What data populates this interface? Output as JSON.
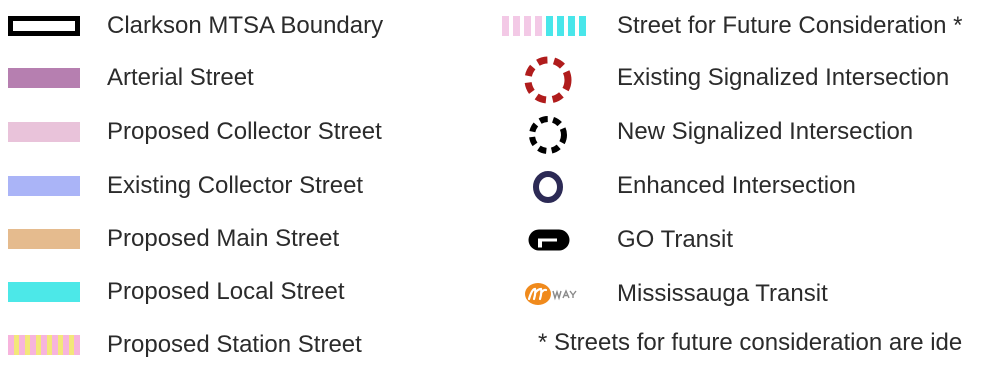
{
  "legend": {
    "left": [
      {
        "label": "Clarkson MTSA Boundary",
        "symbol": "boundary-box-icon",
        "color": "#000000"
      },
      {
        "label": "Arterial Street",
        "symbol": "arterial-street-swatch",
        "color": "#b67fb0"
      },
      {
        "label": "Proposed Collector Street",
        "symbol": "proposed-collector-swatch",
        "color": "#e9c3da"
      },
      {
        "label": "Existing Collector Street",
        "symbol": "existing-collector-swatch",
        "color": "#aab4f7"
      },
      {
        "label": "Proposed Main Street",
        "symbol": "proposed-main-swatch",
        "color": "#e5bb8e"
      },
      {
        "label": "Proposed Local Street",
        "symbol": "proposed-local-swatch",
        "color": "#4ce8e8"
      },
      {
        "label": "Proposed Station Street",
        "symbol": "proposed-station-striped-swatch",
        "color": "#f7b4dd / #f3e77a"
      }
    ],
    "right": [
      {
        "label": "Street for Future Consideration *",
        "symbol": "future-street-striped-swatch",
        "color": "#f3c9e6 / #49e6ea"
      },
      {
        "label": "Existing Signalized Intersection",
        "symbol": "dashed-circle-red-icon",
        "color": "#b01c1c"
      },
      {
        "label": "New Signalized Intersection",
        "symbol": "dashed-circle-black-icon",
        "color": "#000000"
      },
      {
        "label": "Enhanced Intersection",
        "symbol": "ring-navy-icon",
        "color": "#2c2a55"
      },
      {
        "label": "GO Transit",
        "symbol": "go-transit-logo-icon",
        "color": "#000000"
      },
      {
        "label": "Mississauga Transit",
        "symbol": "miway-logo-icon",
        "color": "#f08a1c"
      }
    ],
    "footnote": "* Streets for future consideration are ide"
  }
}
